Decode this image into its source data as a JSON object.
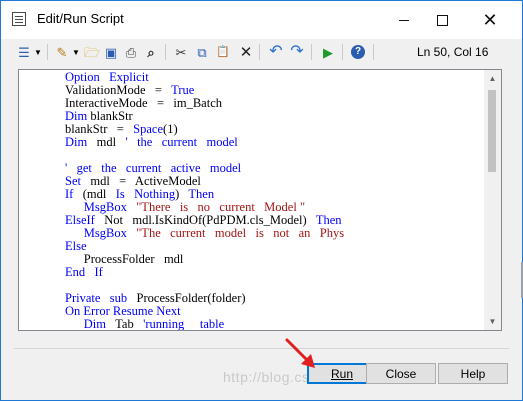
{
  "window": {
    "title": "Edit/Run Script",
    "app_icon": "script-window-icon",
    "controls": {
      "minimize": "minimize-icon",
      "maximize": "maximize-icon",
      "close_glyph": "✕"
    }
  },
  "toolbar": {
    "buttons": [
      {
        "name": "script-list-icon",
        "glyph": "☰"
      },
      {
        "name": "edit-script-icon",
        "glyph": "✎"
      },
      {
        "name": "open-folder-icon",
        "glyph": "🗁"
      },
      {
        "name": "save-icon",
        "glyph": "▣"
      },
      {
        "name": "print-icon",
        "glyph": "⎙"
      },
      {
        "name": "find-icon",
        "glyph": "⌕"
      },
      {
        "name": "cut-icon",
        "glyph": "✂"
      },
      {
        "name": "copy-icon",
        "glyph": "⧉"
      },
      {
        "name": "paste-icon",
        "glyph": "📋"
      },
      {
        "name": "delete-icon",
        "glyph": "✕"
      },
      {
        "name": "undo-icon",
        "glyph": "↶"
      },
      {
        "name": "redo-icon",
        "glyph": "↷"
      },
      {
        "name": "run-icon",
        "glyph": "▶"
      },
      {
        "name": "help-icon",
        "glyph": "?"
      }
    ],
    "position_label": "Ln 50, Col 16"
  },
  "editor": {
    "lines": [
      [
        {
          "t": "Option   Explicit",
          "c": "kw"
        }
      ],
      [
        {
          "t": "ValidationMode   =   ",
          "c": ""
        },
        {
          "t": "True",
          "c": "kw"
        }
      ],
      [
        {
          "t": "InteractiveMode   =   im_Batch",
          "c": ""
        }
      ],
      [
        {
          "t": "Dim",
          "c": "kw"
        },
        {
          "t": " blankStr",
          "c": ""
        }
      ],
      [
        {
          "t": "blankStr   =   ",
          "c": ""
        },
        {
          "t": "Space",
          "c": "kw"
        },
        {
          "t": "(1)",
          "c": ""
        }
      ],
      [
        {
          "t": "Dim",
          "c": "kw"
        },
        {
          "t": "   mdl   ",
          "c": ""
        },
        {
          "t": "'   the   current   model",
          "c": "kw"
        }
      ],
      [
        {
          "t": "",
          "c": ""
        }
      ],
      [
        {
          "t": "'   get   the   current   active   model",
          "c": "kw"
        }
      ],
      [
        {
          "t": "Set",
          "c": "kw"
        },
        {
          "t": "   mdl   =   ActiveModel",
          "c": ""
        }
      ],
      [
        {
          "t": "If",
          "c": "kw"
        },
        {
          "t": "   (mdl   ",
          "c": ""
        },
        {
          "t": "Is",
          "c": "kw"
        },
        {
          "t": "   ",
          "c": ""
        },
        {
          "t": "Nothing",
          "c": "kw"
        },
        {
          "t": ")   ",
          "c": ""
        },
        {
          "t": "Then",
          "c": "kw"
        }
      ],
      [
        {
          "t": "      ",
          "c": ""
        },
        {
          "t": "MsgBox",
          "c": "kw"
        },
        {
          "t": "   ",
          "c": ""
        },
        {
          "t": "\"There   is   no   current   Model \"",
          "c": "str"
        }
      ],
      [
        {
          "t": "ElseIf",
          "c": "kw"
        },
        {
          "t": "   Not   mdl.IsKindOf(PdPDM.cls_Model)   ",
          "c": ""
        },
        {
          "t": "Then",
          "c": "kw"
        }
      ],
      [
        {
          "t": "      ",
          "c": ""
        },
        {
          "t": "MsgBox",
          "c": "kw"
        },
        {
          "t": "   ",
          "c": ""
        },
        {
          "t": "\"The   current   model   is   not   an   Phys",
          "c": "str"
        }
      ],
      [
        {
          "t": "Else",
          "c": "kw"
        }
      ],
      [
        {
          "t": "      ProcessFolder   mdl",
          "c": ""
        }
      ],
      [
        {
          "t": "End",
          "c": "kw"
        },
        {
          "t": "   ",
          "c": ""
        },
        {
          "t": "If",
          "c": "kw"
        }
      ],
      [
        {
          "t": "",
          "c": ""
        }
      ],
      [
        {
          "t": "Private",
          "c": "kw"
        },
        {
          "t": "   ",
          "c": ""
        },
        {
          "t": "sub",
          "c": "kw"
        },
        {
          "t": "   ProcessFolder(folder)",
          "c": ""
        }
      ],
      [
        {
          "t": "On Error Resume Next",
          "c": "kw"
        }
      ],
      [
        {
          "t": "      ",
          "c": ""
        },
        {
          "t": "Dim",
          "c": "kw"
        },
        {
          "t": "   Tab   ",
          "c": ""
        },
        {
          "t": "'running     table",
          "c": "kw"
        }
      ]
    ]
  },
  "buttons": {
    "run_label": "Run",
    "close_label": "Close",
    "help_label": "Help"
  },
  "watermark": "http://blog.csdn.net/diffrate",
  "colors": {
    "keyword": "#0000ff",
    "string": "#a31515",
    "accent": "#0078d7",
    "arrow": "#e02020"
  }
}
